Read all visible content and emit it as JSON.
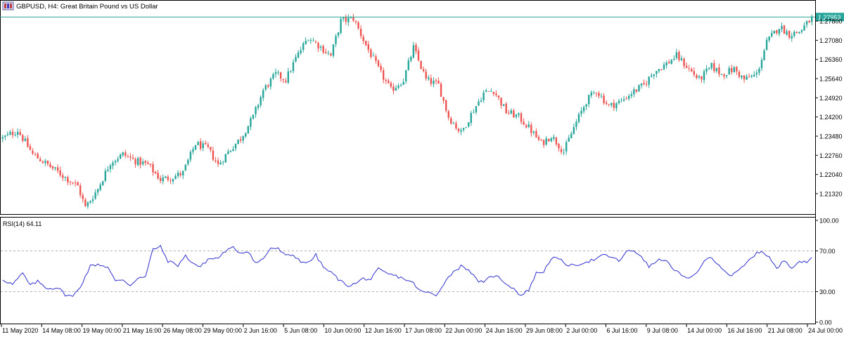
{
  "header": {
    "symbol_title": "GBPUSD, H4:  Great Britain Pound vs US Dollar",
    "icon": "chart-window-icon"
  },
  "colors": {
    "bull": "#26a69a",
    "bear": "#ef5350",
    "wick": "#555555",
    "rsi_line": "#3030d0",
    "price_line": "#26a69a",
    "price_tag_bg": "#26a69a",
    "price_tag_text": "#ffffff",
    "axis": "#000000",
    "level_line": "#b0b0b0"
  },
  "chart_data": [
    {
      "type": "candlestick",
      "title": "GBPUSD, H4:  Great Britain Pound vs US Dollar",
      "current_price": "1.27953",
      "y_ticks": [
        "1.27800",
        "1.27080",
        "1.26360",
        "1.25640",
        "1.24920",
        "1.24200",
        "1.23480",
        "1.22760",
        "1.22040",
        "1.21320"
      ],
      "ylim": [
        1.2058,
        1.2854
      ],
      "x_ticks": [
        "11 May 2020",
        "14 May 08:00",
        "19 May 00:00",
        "21 May 16:00",
        "26 May 08:00",
        "29 May 00:00",
        "2 Jun 16:00",
        "5 Jun 08:00",
        "10 Jun 00:00",
        "12 Jun 16:00",
        "17 Jun 08:00",
        "22 Jun 00:00",
        "24 Jun 16:00",
        "29 Jun 08:00",
        "2 Jul 00:00",
        "6 Jul 16:00",
        "9 Jul 08:00",
        "14 Jul 00:00",
        "16 Jul 16:00",
        "21 Jul 08:00",
        "24 Jul 00:00"
      ],
      "close_path": [
        [
          0,
          1.234
        ],
        [
          6,
          1.237
        ],
        [
          12,
          1.228
        ],
        [
          18,
          1.224
        ],
        [
          24,
          1.22
        ],
        [
          30,
          1.216
        ],
        [
          33,
          1.208
        ],
        [
          38,
          1.215
        ],
        [
          43,
          1.225
        ],
        [
          48,
          1.228
        ],
        [
          53,
          1.2255
        ],
        [
          58,
          1.224
        ],
        [
          63,
          1.2185
        ],
        [
          68,
          1.2195
        ],
        [
          72,
          1.221
        ],
        [
          77,
          1.232
        ],
        [
          82,
          1.23
        ],
        [
          86,
          1.224
        ],
        [
          91,
          1.23
        ],
        [
          95,
          1.234
        ],
        [
          100,
          1.242
        ],
        [
          104,
          1.252
        ],
        [
          109,
          1.258
        ],
        [
          113,
          1.256
        ],
        [
          117,
          1.264
        ],
        [
          122,
          1.272
        ],
        [
          126,
          1.269
        ],
        [
          131,
          1.265
        ],
        [
          135,
          1.278
        ],
        [
          140,
          1.279
        ],
        [
          145,
          1.269
        ],
        [
          150,
          1.26
        ],
        [
          155,
          1.252
        ],
        [
          160,
          1.256
        ],
        [
          164,
          1.268
        ],
        [
          169,
          1.256
        ],
        [
          174,
          1.254
        ],
        [
          178,
          1.242
        ],
        [
          183,
          1.236
        ],
        [
          187,
          1.243
        ],
        [
          192,
          1.251
        ],
        [
          196,
          1.252
        ],
        [
          201,
          1.244
        ],
        [
          206,
          1.242
        ],
        [
          210,
          1.238
        ],
        [
          215,
          1.232
        ],
        [
          219,
          1.235
        ],
        [
          224,
          1.229
        ],
        [
          228,
          1.238
        ],
        [
          233,
          1.248
        ],
        [
          237,
          1.252
        ],
        [
          242,
          1.246
        ],
        [
          247,
          1.248
        ],
        [
          251,
          1.251
        ],
        [
          256,
          1.254
        ],
        [
          260,
          1.259
        ],
        [
          265,
          1.262
        ],
        [
          269,
          1.265
        ],
        [
          274,
          1.26
        ],
        [
          278,
          1.256
        ],
        [
          283,
          1.261
        ],
        [
          287,
          1.258
        ],
        [
          292,
          1.26
        ],
        [
          296,
          1.256
        ],
        [
          301,
          1.258
        ],
        [
          305,
          1.27
        ],
        [
          310,
          1.276
        ],
        [
          314,
          1.273
        ],
        [
          318,
          1.274
        ],
        [
          323,
          1.279
        ]
      ],
      "candle_count": 324
    },
    {
      "type": "line",
      "title": "RSI(14) 64.11",
      "label": "RSI(14)",
      "value": "64.11",
      "y_ticks": [
        "100.00",
        "70.00",
        "30.00",
        "0.00"
      ],
      "ylim": [
        0,
        100
      ],
      "levels": [
        30,
        70
      ],
      "rsi_path": [
        [
          0,
          42
        ],
        [
          4,
          37
        ],
        [
          8,
          48
        ],
        [
          11,
          36
        ],
        [
          14,
          40
        ],
        [
          18,
          33
        ],
        [
          22,
          34
        ],
        [
          25,
          27
        ],
        [
          28,
          25
        ],
        [
          31,
          35
        ],
        [
          35,
          55
        ],
        [
          38,
          57
        ],
        [
          42,
          54
        ],
        [
          45,
          40
        ],
        [
          48,
          42
        ],
        [
          51,
          36
        ],
        [
          54,
          44
        ],
        [
          57,
          44
        ],
        [
          60,
          72
        ],
        [
          63,
          74
        ],
        [
          66,
          60
        ],
        [
          70,
          56
        ],
        [
          73,
          65
        ],
        [
          76,
          58
        ],
        [
          79,
          54
        ],
        [
          82,
          62
        ],
        [
          86,
          63
        ],
        [
          89,
          70
        ],
        [
          92,
          73
        ],
        [
          95,
          68
        ],
        [
          98,
          70
        ],
        [
          101,
          58
        ],
        [
          104,
          62
        ],
        [
          107,
          73
        ],
        [
          110,
          72
        ],
        [
          113,
          65
        ],
        [
          116,
          66
        ],
        [
          119,
          60
        ],
        [
          122,
          58
        ],
        [
          125,
          66
        ],
        [
          128,
          54
        ],
        [
          132,
          47
        ],
        [
          135,
          40
        ],
        [
          138,
          36
        ],
        [
          141,
          38
        ],
        [
          144,
          43
        ],
        [
          147,
          42
        ],
        [
          150,
          52
        ],
        [
          153,
          48
        ],
        [
          156,
          46
        ],
        [
          160,
          43
        ],
        [
          164,
          38
        ],
        [
          167,
          30
        ],
        [
          170,
          29
        ],
        [
          173,
          26
        ],
        [
          176,
          38
        ],
        [
          180,
          50
        ],
        [
          183,
          55
        ],
        [
          186,
          52
        ],
        [
          189,
          42
        ],
        [
          192,
          38
        ],
        [
          195,
          46
        ],
        [
          198,
          44
        ],
        [
          201,
          38
        ],
        [
          204,
          33
        ],
        [
          207,
          26
        ],
        [
          210,
          32
        ],
        [
          213,
          48
        ],
        [
          216,
          50
        ],
        [
          219,
          63
        ],
        [
          222,
          62
        ],
        [
          225,
          57
        ],
        [
          228,
          55
        ],
        [
          231,
          58
        ],
        [
          234,
          60
        ],
        [
          237,
          62
        ],
        [
          240,
          66
        ],
        [
          243,
          64
        ],
        [
          246,
          60
        ],
        [
          249,
          69
        ],
        [
          252,
          70
        ],
        [
          255,
          65
        ],
        [
          258,
          54
        ],
        [
          261,
          60
        ],
        [
          264,
          62
        ],
        [
          267,
          54
        ],
        [
          270,
          48
        ],
        [
          273,
          42
        ],
        [
          276,
          46
        ],
        [
          279,
          56
        ],
        [
          282,
          64
        ],
        [
          285,
          59
        ],
        [
          288,
          51
        ],
        [
          291,
          45
        ],
        [
          294,
          51
        ],
        [
          297,
          58
        ],
        [
          300,
          66
        ],
        [
          303,
          70
        ],
        [
          306,
          64
        ],
        [
          309,
          52
        ],
        [
          312,
          61
        ],
        [
          315,
          54
        ],
        [
          318,
          60
        ],
        [
          321,
          58
        ],
        [
          323,
          64
        ]
      ]
    }
  ]
}
